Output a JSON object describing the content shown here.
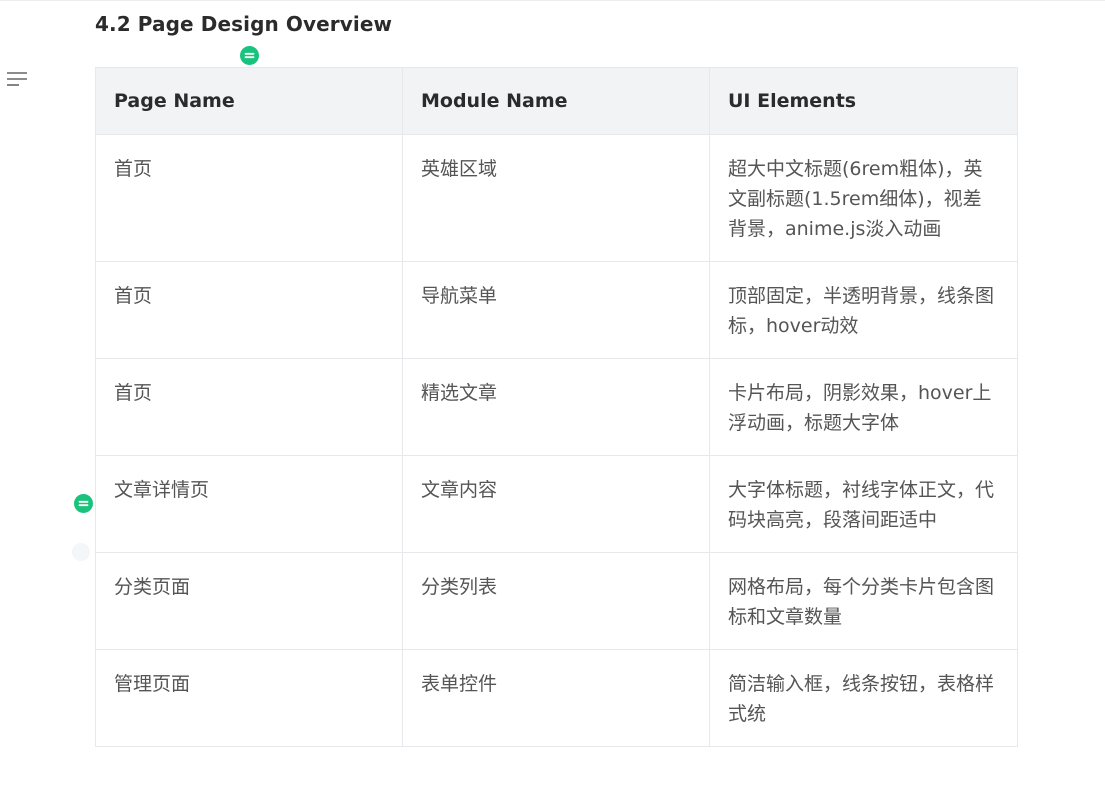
{
  "section": {
    "heading": "4.2 Page Design Overview"
  },
  "icons": {
    "outline_toggle": "menu-lines-icon",
    "block_handle": "equals-circle-icon"
  },
  "colors": {
    "accent": "#19c37d",
    "header_bg": "#f2f3f5",
    "border": "#e6e8eb"
  },
  "table": {
    "headers": [
      "Page Name",
      "Module Name",
      "UI Elements"
    ],
    "rows": [
      [
        "首页",
        "英雄区域",
        "超大中文标题(6rem粗体)，英文副标题(1.5rem细体)，视差背景，anime.js淡入动画"
      ],
      [
        "首页",
        "导航菜单",
        "顶部固定，半透明背景，线条图标，hover动效"
      ],
      [
        "首页",
        "精选文章",
        "卡片布局，阴影效果，hover上浮动画，标题大字体"
      ],
      [
        "文章详情页",
        "文章内容",
        "大字体标题，衬线字体正文，代码块高亮，段落间距适中"
      ],
      [
        "分类页面",
        "分类列表",
        "网格布局，每个分类卡片包含图标和文章数量"
      ],
      [
        "管理页面",
        "表单控件",
        "简洁输入框，线条按钮，表格样式统"
      ]
    ]
  }
}
